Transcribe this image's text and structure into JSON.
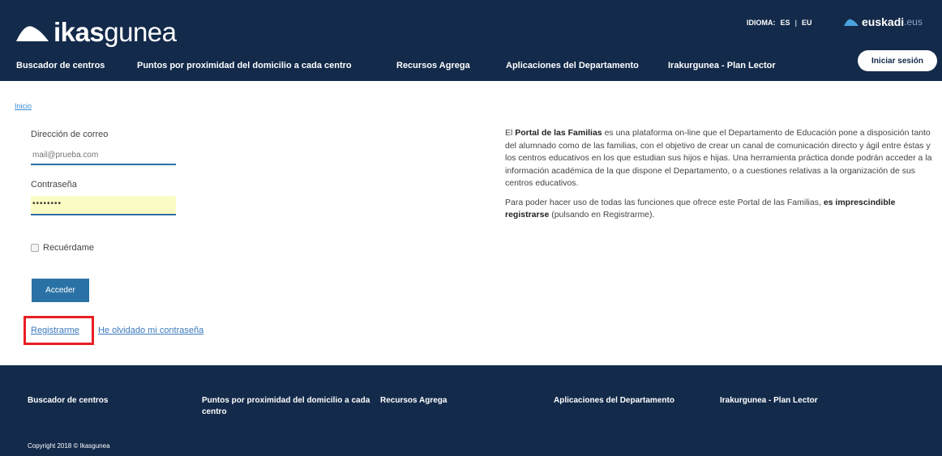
{
  "header": {
    "logo_bold": "ikas",
    "logo_light": "gunea",
    "lang_label": "IDIOMA:",
    "lang_es": "ES",
    "lang_sep": "|",
    "lang_eu": "EU",
    "euskadi_bold": "euskadi",
    "euskadi_tld": ".eus",
    "login_button": "Iniciar sesión",
    "nav": [
      "Buscador de centros",
      "Puntos por proximidad del domicilio a cada centro",
      "Recursos Agrega",
      "Aplicaciones del Departamento",
      "Irakurgunea - Plan Lector"
    ]
  },
  "breadcrumb": "Inicio",
  "form": {
    "email_label": "Dirección de correo",
    "email_placeholder": "mail@prueba.com",
    "password_label": "Contraseña",
    "password_value": "••••••••",
    "remember_label": "Recuérdame",
    "submit_label": "Acceder",
    "register_link": "Registrarme",
    "forgot_link": "He olvidado mi contraseña"
  },
  "info": {
    "p1_pre": "El ",
    "p1_bold": "Portal de las Familias",
    "p1_post": " es una plataforma on-line que el Departamento de Educación pone a disposición tanto del alumnado como de las familias, con el objetivo de crear un canal de comunicación directo y ágil entre éstas y los centros educativos en los que estudian sus hijos e hijas. Una herramienta práctica donde podrán acceder a la información académica de la que dispone el Departamento, o a cuestiones relativas a la organización de sus centros educativos.",
    "p2_pre": "Para poder hacer uso de todas las funciones que ofrece este Portal de las Familias, ",
    "p2_bold": "es imprescindible registrarse",
    "p2_post": " (pulsando en Registrarme)."
  },
  "footer": {
    "nav": [
      "Buscador de centros",
      "Puntos por proximidad del domicilio a cada centro",
      "Recursos Agrega",
      "Aplicaciones del Departamento",
      "Irakurgunea - Plan Lector"
    ],
    "copyright": "Copyright 2018 © Ikasgunea"
  },
  "colors": {
    "navy": "#132a4a",
    "accent_blue": "#2a72a6",
    "highlight_red": "#e81f25"
  }
}
